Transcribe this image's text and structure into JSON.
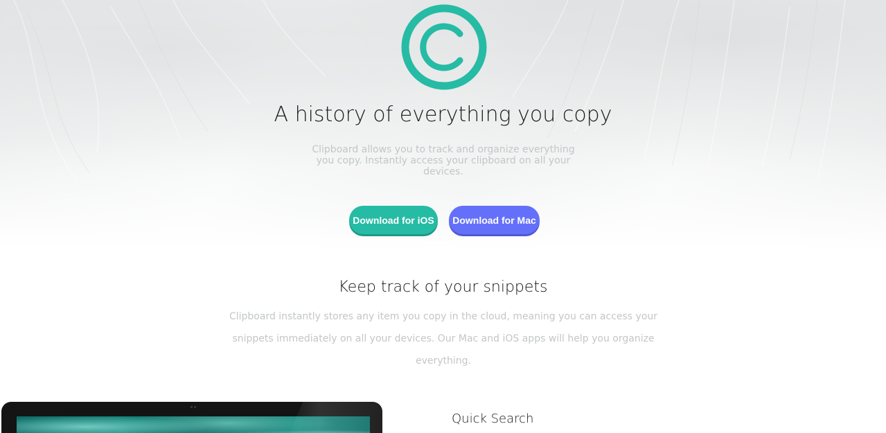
{
  "hero": {
    "title": "A history of everything you copy",
    "subtitle": "Clipboard allows you to track and organize everything you copy. Instantly access your clipboard on all your devices.",
    "logo_icon": "copyright-logo-icon"
  },
  "buttons": {
    "ios_label": "Download for iOS",
    "mac_label": "Download for Mac"
  },
  "snippets": {
    "title": "Keep track of your snippets",
    "body": "Clipboard instantly stores any item you copy in the cloud, meaning you can access your snippets immediately on all your devices. Our Mac and iOS apps will help you organize everything."
  },
  "feature": {
    "title": "Quick Search"
  },
  "colors": {
    "accent_teal": "#26bba4",
    "accent_blue": "#6470fa",
    "muted_text": "#c3c6c7",
    "heading_text": "#1c1c1c"
  }
}
